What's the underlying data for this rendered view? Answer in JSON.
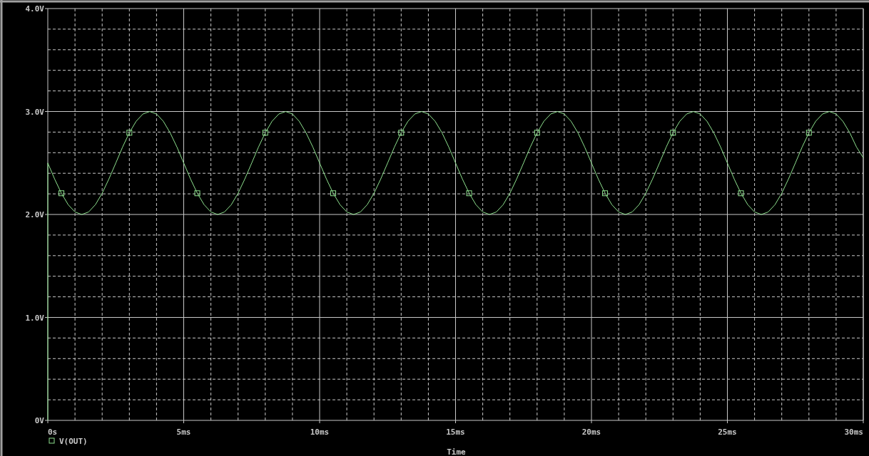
{
  "plot": {
    "chart_data": {
      "type": "line",
      "xlabel": "Time",
      "grid": true,
      "x": [
        0,
        0,
        0.25,
        0.5,
        0.75,
        1,
        1.25,
        1.5,
        1.75,
        2,
        2.25,
        2.5,
        2.75,
        3,
        3.25,
        3.5,
        3.75,
        4,
        4.25,
        4.5,
        4.75,
        5,
        5.25,
        5.5,
        5.75,
        6,
        6.25,
        6.5,
        6.75,
        7,
        7.25,
        7.5,
        7.75,
        8,
        8.25,
        8.5,
        8.75,
        9,
        9.25,
        9.5,
        9.75,
        10,
        10.25,
        10.5,
        10.75,
        11,
        11.25,
        11.5,
        11.75,
        12,
        12.25,
        12.5,
        12.75,
        13,
        13.25,
        13.5,
        13.75,
        14,
        14.25,
        14.5,
        14.75,
        15,
        15.25,
        15.5,
        15.75,
        16,
        16.25,
        16.5,
        16.75,
        17,
        17.25,
        17.5,
        17.75,
        18,
        18.25,
        18.5,
        18.75,
        19,
        19.25,
        19.5,
        19.75,
        20,
        20.25,
        20.5,
        20.75,
        21,
        21.25,
        21.5,
        21.75,
        22,
        22.25,
        22.5,
        22.75,
        23,
        23.25,
        23.5,
        23.75,
        24,
        24.25,
        24.5,
        24.75,
        25,
        25.25,
        25.5,
        25.75,
        26,
        26.25,
        26.5,
        26.75,
        27,
        27.25,
        27.5,
        27.75,
        28,
        28.25,
        28.5,
        28.75,
        29,
        29.25,
        29.5,
        29.75,
        30
      ],
      "series": [
        {
          "name": "V(OUT)",
          "color": "#8ee08e",
          "values": [
            0,
            2.5,
            2.345,
            2.206,
            2.095,
            2.024,
            2.0,
            2.024,
            2.095,
            2.206,
            2.345,
            2.5,
            2.655,
            2.794,
            2.905,
            2.976,
            3.0,
            2.976,
            2.905,
            2.794,
            2.655,
            2.5,
            2.345,
            2.206,
            2.095,
            2.024,
            2.0,
            2.024,
            2.095,
            2.206,
            2.345,
            2.5,
            2.655,
            2.794,
            2.905,
            2.976,
            3.0,
            2.976,
            2.905,
            2.794,
            2.655,
            2.5,
            2.345,
            2.206,
            2.095,
            2.024,
            2.0,
            2.024,
            2.095,
            2.206,
            2.345,
            2.5,
            2.655,
            2.794,
            2.905,
            2.976,
            3.0,
            2.976,
            2.905,
            2.794,
            2.655,
            2.5,
            2.345,
            2.206,
            2.095,
            2.024,
            2.0,
            2.024,
            2.095,
            2.206,
            2.345,
            2.5,
            2.655,
            2.794,
            2.905,
            2.976,
            3.0,
            2.976,
            2.905,
            2.794,
            2.655,
            2.5,
            2.345,
            2.206,
            2.095,
            2.024,
            2.0,
            2.024,
            2.095,
            2.206,
            2.345,
            2.5,
            2.655,
            2.794,
            2.905,
            2.976,
            3.0,
            2.976,
            2.905,
            2.794,
            2.655,
            2.5,
            2.345,
            2.206,
            2.095,
            2.024,
            2.0,
            2.024,
            2.095,
            2.206,
            2.345,
            2.5,
            2.655,
            2.794,
            2.905,
            2.976,
            3.0,
            2.976,
            2.905,
            2.794,
            2.655,
            2.55
          ]
        }
      ],
      "xlim": [
        0,
        30
      ],
      "ylim": [
        0,
        4
      ],
      "xticks": [
        {
          "value": 0,
          "label": "0s"
        },
        {
          "value": 5,
          "label": "5ms"
        },
        {
          "value": 10,
          "label": "10ms"
        },
        {
          "value": 15,
          "label": "15ms"
        },
        {
          "value": 20,
          "label": "20ms"
        },
        {
          "value": 25,
          "label": "25ms"
        },
        {
          "value": 30,
          "label": "30ms"
        }
      ],
      "yticks": [
        {
          "value": 0,
          "label": "0V"
        },
        {
          "value": 1,
          "label": "1.0V"
        },
        {
          "value": 2,
          "label": "2.0V"
        },
        {
          "value": 3,
          "label": "3.0V"
        },
        {
          "value": 4,
          "label": "4.0V"
        }
      ]
    }
  }
}
